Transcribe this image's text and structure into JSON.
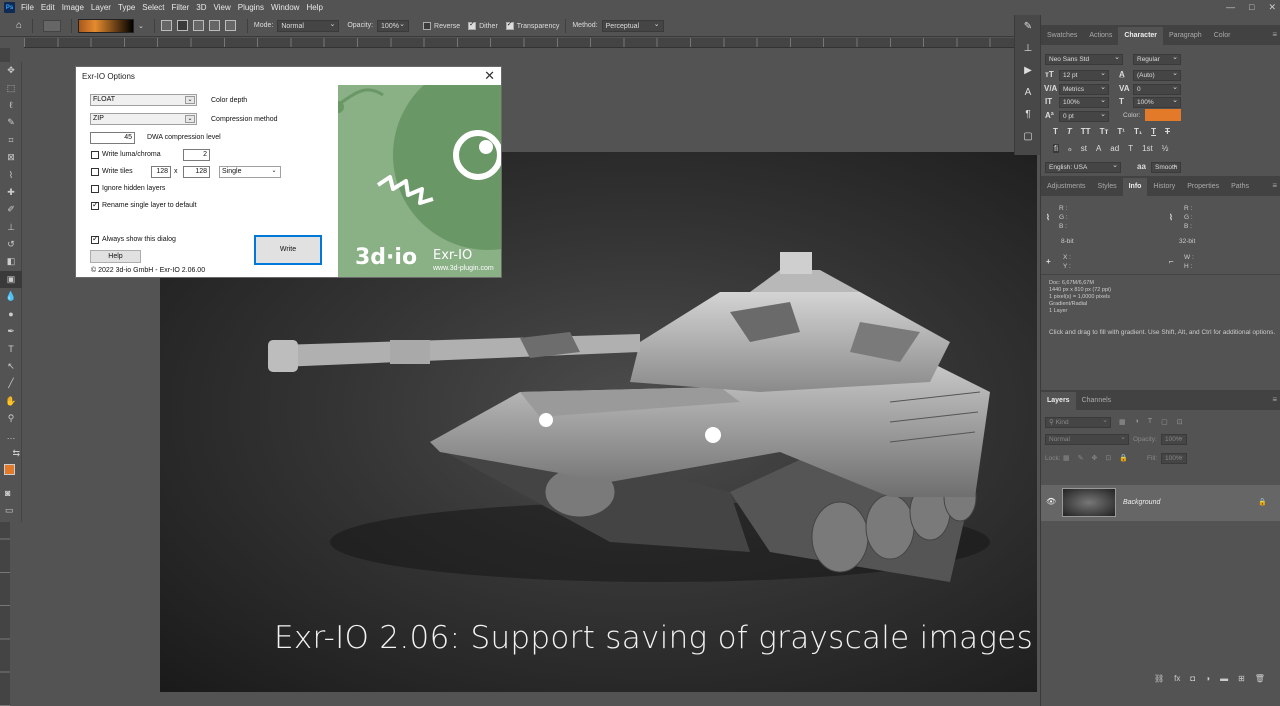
{
  "menubar": {
    "items": [
      "File",
      "Edit",
      "Image",
      "Layer",
      "Type",
      "Select",
      "Filter",
      "3D",
      "View",
      "Plugins",
      "Window",
      "Help"
    ]
  },
  "options_bar": {
    "mode_label": "Mode:",
    "mode_value": "Normal",
    "opacity_label": "Opacity:",
    "opacity_value": "100%",
    "reverse_label": "Reverse",
    "dither_label": "Dither",
    "transparency_label": "Transparency",
    "method_label": "Method:",
    "method_value": "Perceptual"
  },
  "dialog": {
    "title": "Exr-IO Options",
    "color_depth_value": "FLOAT",
    "color_depth_label": "Color depth",
    "compression_value": "ZIP",
    "compression_label": "Compression method",
    "dwa_value": "45",
    "dwa_label": "DWA compression level",
    "write_luma_label": "Write luma/chroma",
    "luma_value": "2",
    "write_tiles_label": "Write tiles",
    "tile_w": "128",
    "tile_x": "x",
    "tile_h": "128",
    "tile_mode": "Single",
    "ignore_hidden_label": "Ignore hidden layers",
    "rename_label": "Rename single layer to default",
    "always_show_label": "Always show this dialog",
    "help_button": "Help",
    "write_button": "Write",
    "copyright": "© 2022 3d-io GmbH - Exr-IO 2.06.00",
    "logo_brand": "3d·io",
    "logo_product": "Exr-IO",
    "logo_url": "www.3d-plugin.com"
  },
  "canvas": {
    "caption": "Exr-IO 2.06:  Support saving of grayscale images"
  },
  "character_panel": {
    "tabs": [
      "Swatches",
      "Actions",
      "Character",
      "Paragraph",
      "Color"
    ],
    "font_family": "Neo Sans Std",
    "font_style": "Regular",
    "size": "12 pt",
    "leading": "(Auto)",
    "kerning": "Metrics",
    "tracking": "0",
    "vscale": "100%",
    "hscale": "100%",
    "baseline": "0 pt",
    "color_label": "Color:",
    "language": "English: USA",
    "antialias": "Smooth",
    "typo_buttons": [
      "T",
      "T",
      "TT",
      "Tт",
      "T¹",
      "T₁",
      "T",
      "T"
    ],
    "ot_buttons": [
      "fi",
      "ℴ",
      "st",
      "A",
      "ad",
      "T",
      "1st",
      "½"
    ]
  },
  "info_panel": {
    "tabs": [
      "Adjustments",
      "Styles",
      "Info",
      "History",
      "Properties",
      "Paths"
    ],
    "rgb1": [
      "R :",
      "G :",
      "B :"
    ],
    "rgb2": [
      "R :",
      "G :",
      "B :"
    ],
    "bit1": "8-bit",
    "bit2": "32-bit",
    "xy": [
      "X :",
      "Y :"
    ],
    "wh": [
      "W :",
      "H :"
    ],
    "doc": "Doc: 6,67M/6,67M",
    "dims": "1440 px x 810 px (72 ppi)",
    "pixels": "1 pixel(s) = 1,0000 pixels",
    "tool": "Gradient/Radial",
    "layers": "1 Layer",
    "hint": "Click and drag to fill with gradient.  Use Shift, Alt, and Ctrl for additional options."
  },
  "layers_panel": {
    "tabs": [
      "Layers",
      "Channels"
    ],
    "kind": "Kind",
    "blend": "Normal",
    "opacity_label": "Opacity:",
    "opacity": "100%",
    "lock_label": "Lock:",
    "fill_label": "Fill:",
    "fill": "100%",
    "layer_name": "Background"
  },
  "colors": {
    "foreground": "#e37a2a",
    "background": "#111111",
    "logo_green": "#8ab086"
  }
}
